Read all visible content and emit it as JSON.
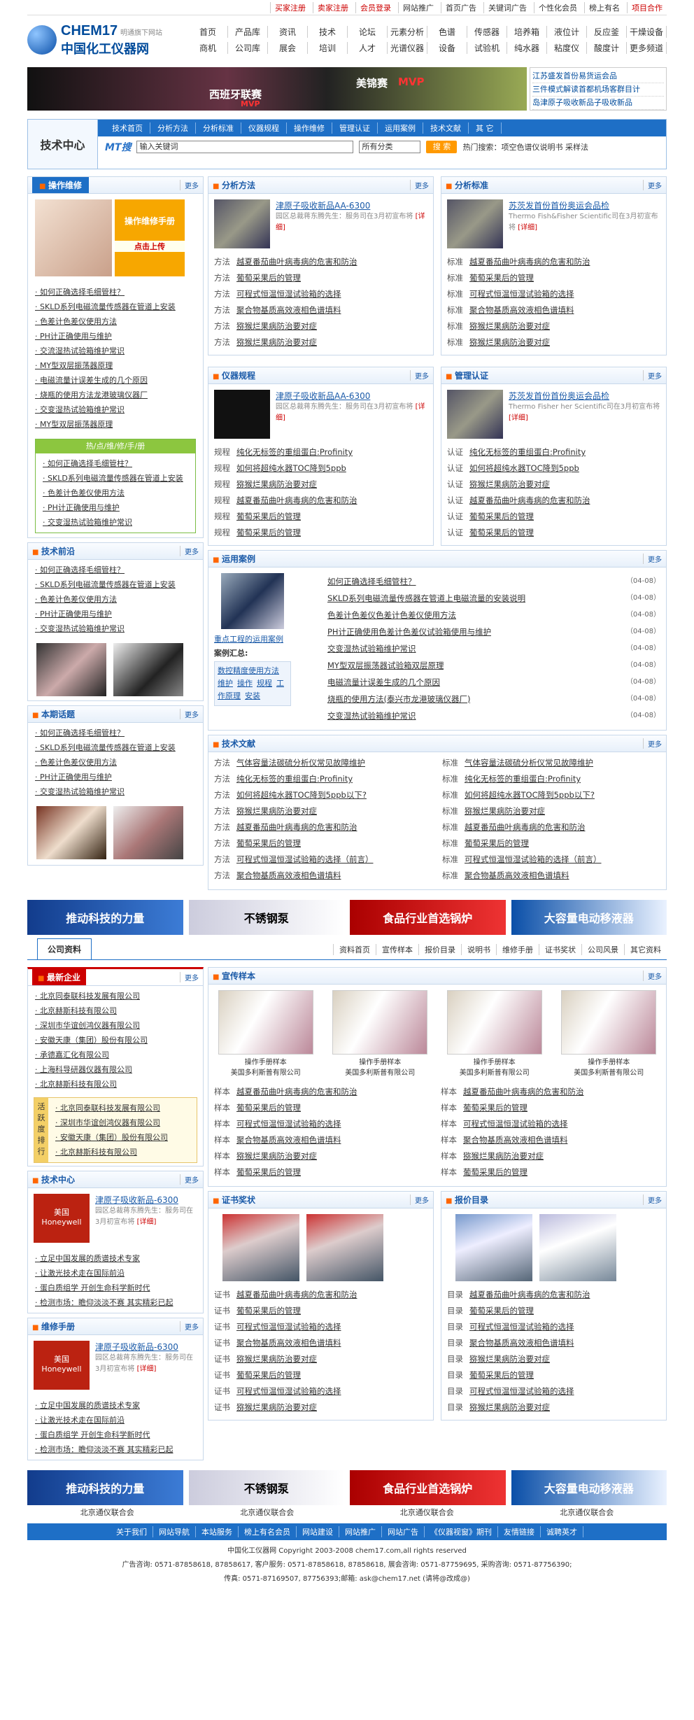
{
  "topbar": {
    "items": [
      "买家注册",
      "卖家注册",
      "会员登录",
      "网站推广",
      "首页广告",
      "关键词广告",
      "个性化会员",
      "榜上有名",
      "项目合作"
    ]
  },
  "logo": {
    "en": "CHEM17",
    "sub": "明通旗下网站",
    "cn": "中国化工仪器网"
  },
  "topnav": [
    "首页",
    "产品库",
    "资讯",
    "技术",
    "论坛",
    "元素分析",
    "色谱",
    "传感器",
    "培养箱",
    "液位计",
    "反应釜",
    "干燥设备",
    "商机",
    "公司库",
    "展会",
    "培训",
    "人才",
    "光谱仪器",
    "设备",
    "试验机",
    "纯水器",
    "粘度仪",
    "酸度计",
    "更多频道"
  ],
  "banner": {
    "left": "西班牙联赛",
    "leftsub": "MVP",
    "mid": "美锦赛",
    "midsub": "MVP",
    "news": [
      "江苏盛发首份易货运会品",
      "三件模式解读首都机场客群目计",
      "岛津原子吸收新品子吸收新品"
    ]
  },
  "techbar": {
    "title": "技术中心",
    "nav": [
      "技术首页",
      "分析方法",
      "分析标准",
      "仪器规程",
      "操作维修",
      "管理认证",
      "运用案例",
      "技术文献",
      "其 它"
    ],
    "search_label": "MT搜",
    "search_value": "输入关键词",
    "select": "所有分类",
    "button": "搜 索",
    "hot": "热门搜索：项空色谱仪说明书  采样法"
  },
  "left": {
    "maint": {
      "title": "操作维修",
      "more": "更多",
      "promo": "操作维修手册",
      "promo_link": "点击上传",
      "list": [
        "如何正确选择毛细管柱？",
        "SKLD系列电磁流量传感器在管道上安装",
        "色差计色差仪使用方法",
        "PH计正确使用与维护",
        "交流湿热试验箱维护常识",
        "MY型双层振荡器原理",
        "电磁流量计误差生成的几个原因",
        "烧瓶的使用方法龙港玻璃仪器厂",
        "交变湿热试验箱维护常识",
        "MY型双层振荡器原理"
      ]
    },
    "hot": {
      "title": "热/点/维/修/手/册",
      "list": [
        "如何正确选择毛细管柱？",
        "SKLD系列电磁流量传感器在管道上安装",
        "色差计色差仪使用方法",
        "PH计正确使用与维护",
        "交变湿热试验箱维护常识"
      ]
    },
    "front": {
      "title": "技术前沿",
      "more": "更多",
      "list": [
        "如何正确选择毛细管柱？",
        "SKLD系列电磁流量传感器在管道上安装",
        "色差计色差仪使用方法",
        "PH计正确使用与维护",
        "交变湿热试验箱维护常识"
      ]
    },
    "topic": {
      "title": "本期话题",
      "more": "更多",
      "list": [
        "如何正确选择毛细管柱？",
        "SKLD系列电磁流量传感器在管道上安装",
        "色差计色差仪使用方法",
        "PH计正确使用与维护",
        "交变湿热试验箱维护常识"
      ]
    }
  },
  "sec": {
    "method": {
      "title": "分析方法",
      "more": "更多",
      "ft": "津原子吸收新品AA-6300",
      "fd": "园区总裁蒋东腾先生：服务司在3月初宣布将",
      "detail": "[详细]",
      "tag": "方法"
    },
    "std": {
      "title": "分析标准",
      "more": "更多",
      "ft": "苏茨发首份首份奥运会品检",
      "fd": "Thermo Fish&Fisher Scientific司在3月初宣布将",
      "detail": "[详细]",
      "tag": "标准"
    },
    "reg": {
      "title": "仪器规程",
      "more": "更多",
      "ft": "津原子吸收新品AA-6300",
      "fd": "园区总裁蒋东腾先生：服务司在3月初宣布将",
      "detail": "[详细]",
      "tag": "规程"
    },
    "cert": {
      "title": "管理认证",
      "more": "更多",
      "ft": "苏茨发首份首份奥运会品检",
      "fd": "Thermo Fisher her Scientific司在3月初宣布将",
      "detail": "[详细]",
      "tag": "认证"
    },
    "list1": [
      "越夏番茄曲叶病毒病的危害和防治",
      "葡萄采果后的管理",
      "可程式恒温恒湿试验箱的选择",
      "聚合物基质高效液相色谱填料",
      "猕猴烂果病防治要对症",
      "猕猴烂果病防治要对症"
    ],
    "list2": [
      "纯化无标签的重组蛋白:Profinity",
      "如何将超纯水器TOC降到5ppb",
      "猕猴烂果病防治要对症",
      "越夏番茄曲叶病毒病的危害和防治",
      "葡萄采果后的管理",
      "葡萄采果后的管理"
    ],
    "case": {
      "title": "运用案例",
      "more": "更多",
      "caption": "重点工程的运用案例",
      "sum": "案例汇总:",
      "links": [
        "数控精度使用方法",
        "维护",
        "操作",
        "规程",
        "工作原理",
        "安装"
      ],
      "list": [
        "如何正确选择毛细管柱？",
        "SKLD系列电磁流量传感器在管道上电磁流量的安装说明",
        "色差计色差仪色差计色差仪使用方法",
        "PH计正确使用色差计色差仪试验箱使用与维护",
        "交变湿热试验箱维护常识",
        "MY型双层振荡器试验箱双层原理",
        "电磁流量计误差生成的几个原因",
        "烧瓶的使用方法(泰兴市龙港玻璃仪器厂)",
        "交变湿热试验箱维护常识"
      ],
      "date": "（04-08）"
    },
    "lit": {
      "title": "技术文献",
      "more": "更多",
      "left": [
        "气体容量法碳硫分析仪常见故障维护",
        "纯化无标签的重组蛋白:Profinity",
        "如何将超纯水器TOC降到5ppb以下?",
        "猕猴烂果病防治要对症",
        "越夏番茄曲叶病毒病的危害和防治",
        "葡萄采果后的管理",
        "可程式恒温恒湿试验箱的选择（前言）",
        "聚合物基质高效液相色谱填料"
      ],
      "ltag": "方法",
      "rtag": "标准"
    }
  },
  "ads": [
    "推动科技的力量",
    "不锈钢泵",
    "食品行业首选锅炉",
    "大容量电动移液器"
  ],
  "company": {
    "tab": "公司资料",
    "tabs": [
      "资料首页",
      "宣传样本",
      "报价目录",
      "说明书",
      "维修手册",
      "证书奖状",
      "公司风景",
      "其它资料"
    ]
  },
  "co_left": {
    "new": {
      "title": "最新企业",
      "more": "更多",
      "list": [
        "北京同泰联科技发展有限公司",
        "北京赫斯科技有限公司",
        "深圳市华谊创鸿仪器有限公司",
        "安徽天康（集团）股份有限公司",
        "承德嘉汇化有限公司",
        "上海科导研器仪器有限公司",
        "北京赫斯科技有限公司"
      ]
    },
    "rank": {
      "label": "活跃度排行",
      "list": [
        "北京同泰联科技发展有限公司",
        "深圳市华谊创鸿仪器有限公司",
        "安徽天康（集团）股份有限公司",
        "北京赫斯科技有限公司"
      ]
    },
    "tech": {
      "title": "技术中心",
      "more": "更多",
      "brand": "Honeywell",
      "brandcn": "美国",
      "ft": "津原子吸收新品-6300",
      "fd": "园区总裁蒋东腾先生：服务司在3月初宣布将",
      "detail": "[详细]",
      "list": [
        "立足中国发展的质谱技术专家",
        "让激光技术走在国际前沿",
        "蛋白质组学 开创生命科学新时代",
        "检测市场：瞻仰淡淡不赛 其实精彩已起"
      ]
    },
    "repair": {
      "title": "维修手册",
      "more": "更多",
      "brand": "Honeywell",
      "brandcn": "美国",
      "ft": "津原子吸收新品-6300",
      "fd": "园区总裁蒋东腾先生：服务司在3月初宣布将",
      "detail": "[详细]",
      "list": [
        "立足中国发展的质谱技术专家",
        "让激光技术走在国际前沿",
        "蛋白质组学 开创生命科学新时代",
        "检测市场：瞻仰淡淡不赛 其实精彩已起"
      ]
    }
  },
  "samples": {
    "title": "宣传样本",
    "more": "更多",
    "items": [
      {
        "a": "操作手册样本",
        "b": "美国多利斯普有限公司"
      },
      {
        "a": "操作手册样本",
        "b": "美国多利斯普有限公司"
      },
      {
        "a": "操作手册样本",
        "b": "美国多利斯普有限公司"
      },
      {
        "a": "操作手册样本",
        "b": "美国多利斯普有限公司"
      }
    ],
    "tag": "样本",
    "list": [
      "越夏番茄曲叶病毒病的危害和防治",
      "葡萄采果后的管理",
      "可程式恒温恒湿试验箱的选择",
      "聚合物基质高效液相色谱填料",
      "猕猴烂果病防治要对症",
      "葡萄采果后的管理"
    ]
  },
  "awards": {
    "title": "证书奖状",
    "more": "更多",
    "tag": "证书",
    "list": [
      "越夏番茄曲叶病毒病的危害和防治",
      "葡萄采果后的管理",
      "可程式恒温恒湿试验箱的选择",
      "聚合物基质高效液相色谱填料",
      "猕猴烂果病防治要对症",
      "葡萄采果后的管理",
      "可程式恒温恒湿试验箱的选择",
      "猕猴烂果病防治要对症"
    ]
  },
  "price": {
    "title": "报价目录",
    "more": "更多",
    "tag": "目录",
    "list": [
      "越夏番茄曲叶病毒病的危害和防治",
      "葡萄采果后的管理",
      "可程式恒温恒湿试验箱的选择",
      "聚合物基质高效液相色谱填料",
      "猕猴烂果病防治要对症",
      "葡萄采果后的管理",
      "可程式恒温恒湿试验箱的选择",
      "猕猴烂果病防治要对症"
    ]
  },
  "adlabels": [
    "北京通仪联合会",
    "北京通仪联合会",
    "北京通仪联合会",
    "北京通仪联合会"
  ],
  "footer": {
    "links": [
      "关于我们",
      "网站导航",
      "本站服务",
      "榜上有名会员",
      "网站建设",
      "网站推广",
      "网站广告",
      "《仪器视窗》期刊",
      "友情链接",
      "诚聘英才"
    ],
    "l1": "中国化工仪器网  Copyright  2003-2008  chem17.com,all  rights  reserved",
    "l2": "广告咨询: 0571-87858618, 87858617, 客户服务: 0571-87858618, 87858618, 展会咨询: 0571-87759695, 采购咨询: 0571-87756390;",
    "l3": "传真: 0571-87169507, 87756393;邮箱: ask@chem17.net (请将@改成@)"
  }
}
